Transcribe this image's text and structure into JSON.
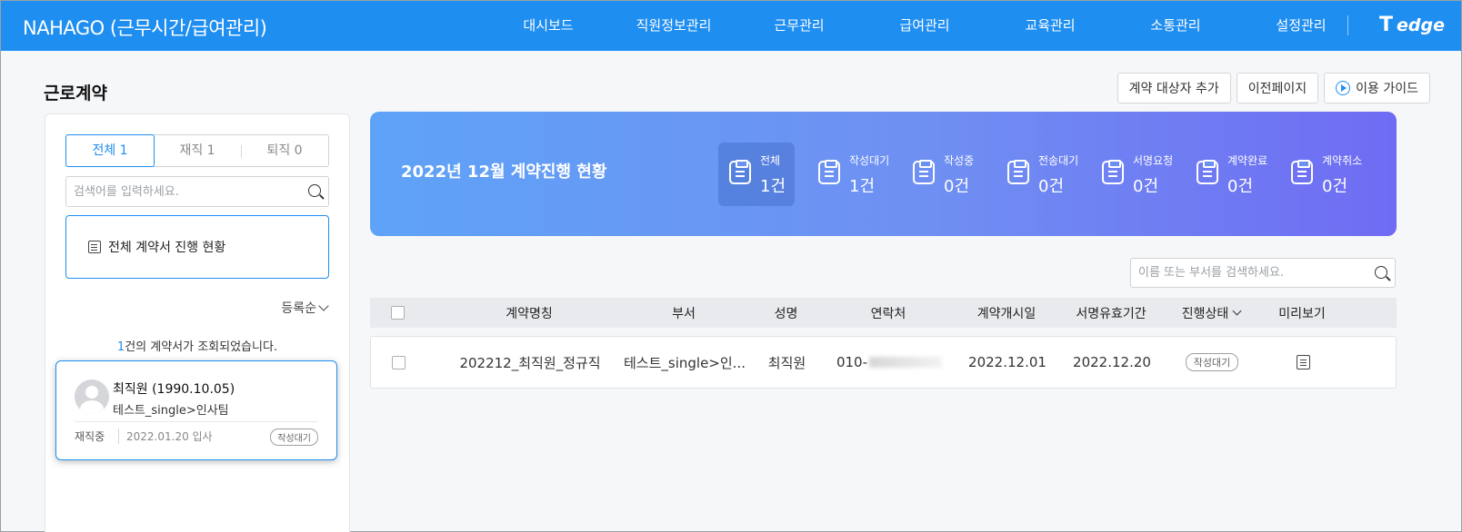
{
  "header": {
    "brand": "NAHAGO (근무시간/급여관리)",
    "nav": [
      "대시보드",
      "직원정보관리",
      "근무관리",
      "급여관리",
      "교육관리",
      "소통관리",
      "설정관리"
    ],
    "logo_text": "edge",
    "logo_mark": "T"
  },
  "page": {
    "title": "근로계약",
    "buttons": {
      "add_target": "계약 대상자 추가",
      "prev_page": "이전페이지",
      "guide": "이용 가이드"
    }
  },
  "left": {
    "tabs": [
      "전체 1",
      "재직 1",
      "퇴직 0"
    ],
    "active_tab": "전체 1",
    "search_placeholder": "검색어를 입력하세요.",
    "status_box_label": "전체 계약서 진행 현황",
    "sort_label": "등록순",
    "result_count_num": "1",
    "result_count_text": "건의 계약서가 조회되었습니다.",
    "employee": {
      "name": "최직원 (1990.10.05)",
      "dept": "테스트_single>인사팀",
      "status": "재직중",
      "join": "2022.01.20 입사",
      "badge": "작성대기"
    }
  },
  "banner": {
    "title": "2022년 12월 계약진행 현황",
    "stats": [
      {
        "label": "전체",
        "value": "1건"
      },
      {
        "label": "작성대기",
        "value": "1건"
      },
      {
        "label": "작성중",
        "value": "0건"
      },
      {
        "label": "전송대기",
        "value": "0건"
      },
      {
        "label": "서명요청",
        "value": "0건"
      },
      {
        "label": "계약완료",
        "value": "0건"
      },
      {
        "label": "계약취소",
        "value": "0건"
      }
    ]
  },
  "table": {
    "search_placeholder": "이름 또는 부서를 검색하세요.",
    "headers": {
      "contract_name": "계약명칭",
      "dept": "부서",
      "name": "성명",
      "phone": "연락처",
      "start": "계약개시일",
      "valid": "서명유효기간",
      "status": "진행상태",
      "preview": "미리보기"
    },
    "rows": [
      {
        "contract_name": "202212_최직원_정규직",
        "dept": "테스트_single>인...",
        "name": "최직원",
        "phone": "010-",
        "start": "2022.12.01",
        "valid": "2022.12.20",
        "status": "작성대기"
      }
    ]
  },
  "colors": {
    "primary": "#1f8ef1",
    "banner_start": "#5ea3f7",
    "banner_end": "#6f6cf3"
  }
}
